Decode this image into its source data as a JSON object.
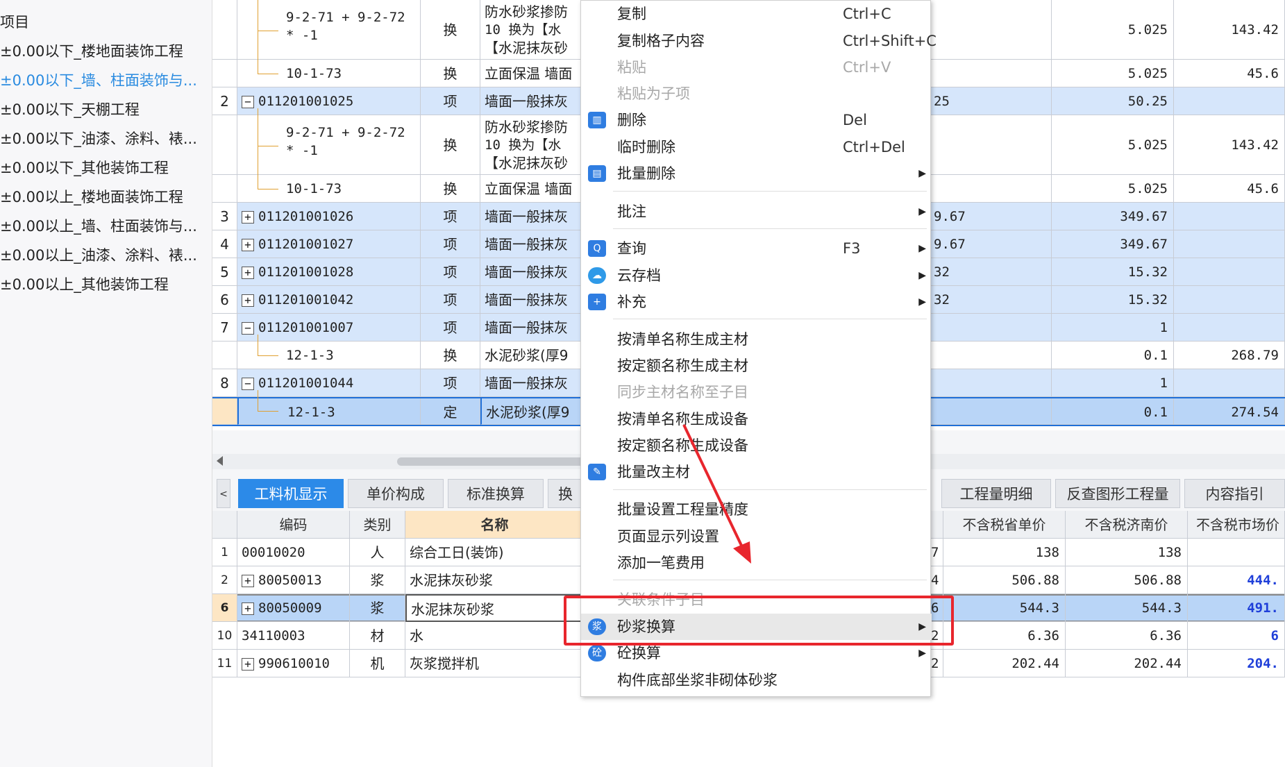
{
  "left_tree": {
    "title": "项目",
    "items": [
      {
        "label": "±0.00以下_楼地面装饰工程",
        "selected": false
      },
      {
        "label": "±0.00以下_墙、柱面装饰与...",
        "selected": true
      },
      {
        "label": "±0.00以下_天棚工程",
        "selected": false
      },
      {
        "label": "±0.00以下_油漆、涂料、裱...",
        "selected": false
      },
      {
        "label": "±0.00以下_其他装饰工程",
        "selected": false
      },
      {
        "label": "±0.00以上_楼地面装饰工程",
        "selected": false
      },
      {
        "label": "±0.00以上_墙、柱面装饰与...",
        "selected": false
      },
      {
        "label": "±0.00以上_油漆、涂料、裱...",
        "selected": false
      },
      {
        "label": "±0.00以上_其他装饰工程",
        "selected": false
      }
    ]
  },
  "top_grid": {
    "rows": [
      {
        "seq": "",
        "code": "9-2-71 + 9-2-72 * -1",
        "code2": "* -1",
        "type": "换",
        "name1": "防水砂浆掺防",
        "name2": "10  换为【水",
        "name3": "【水泥抹灰砂",
        "q": "",
        "v1": "5.025",
        "v2": "143.42"
      },
      {
        "seq": "",
        "code": "10-1-73",
        "type": "换",
        "name1": "立面保温 墙面",
        "q": "",
        "v1": "5.025",
        "v2": "45.6"
      },
      {
        "seq": "2",
        "code": "011201001025",
        "type": "项",
        "name1": "墙面一般抹灰",
        "q": "25",
        "v1": "50.25",
        "v2": ""
      },
      {
        "seq": "",
        "code": "9-2-71 + 9-2-72",
        "code2": "* -1",
        "type": "换",
        "name1": "防水砂浆掺防",
        "name2": "10  换为【水",
        "name3": "【水泥抹灰砂",
        "q": "",
        "v1": "5.025",
        "v2": "143.42"
      },
      {
        "seq": "",
        "code": "10-1-73",
        "type": "换",
        "name1": "立面保温 墙面",
        "q": "",
        "v1": "5.025",
        "v2": "45.6"
      },
      {
        "seq": "3",
        "code": "011201001026",
        "type": "项",
        "name1": "墙面一般抹灰",
        "q": "9.67",
        "v1": "349.67",
        "v2": ""
      },
      {
        "seq": "4",
        "code": "011201001027",
        "type": "项",
        "name1": "墙面一般抹灰",
        "q": "9.67",
        "v1": "349.67",
        "v2": ""
      },
      {
        "seq": "5",
        "code": "011201001028",
        "type": "项",
        "name1": "墙面一般抹灰",
        "q": "32",
        "v1": "15.32",
        "v2": ""
      },
      {
        "seq": "6",
        "code": "011201001042",
        "type": "项",
        "name1": "墙面一般抹灰",
        "q": "32",
        "v1": "15.32",
        "v2": ""
      },
      {
        "seq": "7",
        "code": "011201001007",
        "type": "项",
        "name1": "墙面一般抹灰",
        "q": "",
        "v1": "1",
        "v2": ""
      },
      {
        "seq": "",
        "code": "12-1-3",
        "type": "换",
        "name1": "水泥砂浆(厚9",
        "q": "",
        "v1": "0.1",
        "v2": "268.79"
      },
      {
        "seq": "8",
        "code": "011201001044",
        "type": "项",
        "name1": "墙面一般抹灰",
        "q": "",
        "v1": "1",
        "v2": ""
      },
      {
        "seq": "",
        "code": "12-1-3",
        "type": "定",
        "name1": "水泥砂浆(厚9",
        "q": "",
        "v1": "0.1",
        "v2": "274.54"
      }
    ]
  },
  "tabs": {
    "collapse": "<",
    "left": [
      "工料机显示",
      "单价构成",
      "标准换算",
      "换"
    ],
    "right": [
      "工程量明细",
      "反查图形工程量",
      "内容指引"
    ]
  },
  "bottom_grid": {
    "headers": {
      "seq": "",
      "code": "编码",
      "cat": "类别",
      "name": "名称",
      "q": "",
      "c1": "不含税省单价",
      "c2": "不含税济南价",
      "c3": "不含税市场价"
    },
    "rows": [
      {
        "seq": "1",
        "code": "00010020",
        "cat": "人",
        "name": "综合工日(装饰)",
        "q": "7",
        "c1": "138",
        "c2": "138",
        "c3": ""
      },
      {
        "seq": "2",
        "code": "80050013",
        "cat": "浆",
        "name": "水泥抹灰砂浆",
        "q": "4",
        "c1": "506.88",
        "c2": "506.88",
        "c3": "444."
      },
      {
        "seq": "6",
        "code": "80050009",
        "cat": "浆",
        "name": "水泥抹灰砂浆",
        "q": "6",
        "c1": "544.3",
        "c2": "544.3",
        "c3": "491."
      },
      {
        "seq": "10",
        "code": "34110003",
        "cat": "材",
        "name": "水",
        "q": "2",
        "c1": "6.36",
        "c2": "6.36",
        "c3": "6"
      },
      {
        "seq": "11",
        "code": "990610010",
        "cat": "机",
        "name": "灰浆搅拌机",
        "q": "2",
        "c1": "202.44",
        "c2": "202.44",
        "c3": "204."
      }
    ]
  },
  "context_menu": {
    "items": [
      {
        "label": "复制",
        "shortcut": "Ctrl+C"
      },
      {
        "label": "复制格子内容",
        "shortcut": "Ctrl+Shift+C"
      },
      {
        "label": "粘贴",
        "shortcut": "Ctrl+V"
      },
      {
        "label": "粘贴为子项",
        "shortcut": ""
      },
      {
        "label": "删除",
        "shortcut": "Del"
      },
      {
        "label": "临时删除",
        "shortcut": "Ctrl+Del"
      },
      {
        "label": "批量删除",
        "shortcut": ""
      },
      {
        "label": "批注",
        "shortcut": ""
      },
      {
        "label": "查询",
        "shortcut": "F3"
      },
      {
        "label": "云存档",
        "shortcut": ""
      },
      {
        "label": "补充",
        "shortcut": ""
      },
      {
        "label": "按清单名称生成主材",
        "shortcut": ""
      },
      {
        "label": "按定额名称生成主材",
        "shortcut": ""
      },
      {
        "label": "同步主材名称至子目",
        "shortcut": ""
      },
      {
        "label": "按清单名称生成设备",
        "shortcut": ""
      },
      {
        "label": "按定额名称生成设备",
        "shortcut": ""
      },
      {
        "label": "批量改主材",
        "shortcut": ""
      },
      {
        "label": "批量设置工程量精度",
        "shortcut": ""
      },
      {
        "label": "页面显示列设置",
        "shortcut": ""
      },
      {
        "label": "添加一笔费用",
        "shortcut": ""
      },
      {
        "label": "关联条件子目",
        "shortcut": ""
      },
      {
        "label": "砂浆换算",
        "shortcut": ""
      },
      {
        "label": "砼换算",
        "shortcut": ""
      },
      {
        "label": "构件底部坐浆非砌体砂浆",
        "shortcut": ""
      }
    ],
    "icon_glyphs": {
      "delete": "▥",
      "batch_delete": "▤",
      "query": "Q",
      "cloud": "☁",
      "supplement": "+",
      "batch_material": "✎",
      "mortar": "浆",
      "concrete": "砼"
    }
  },
  "colors": {
    "highlight_box": "#e8262d",
    "arrow": "#e8262d",
    "tab_active": "#2c8ae8",
    "row_blue": "#d6e6fb"
  }
}
